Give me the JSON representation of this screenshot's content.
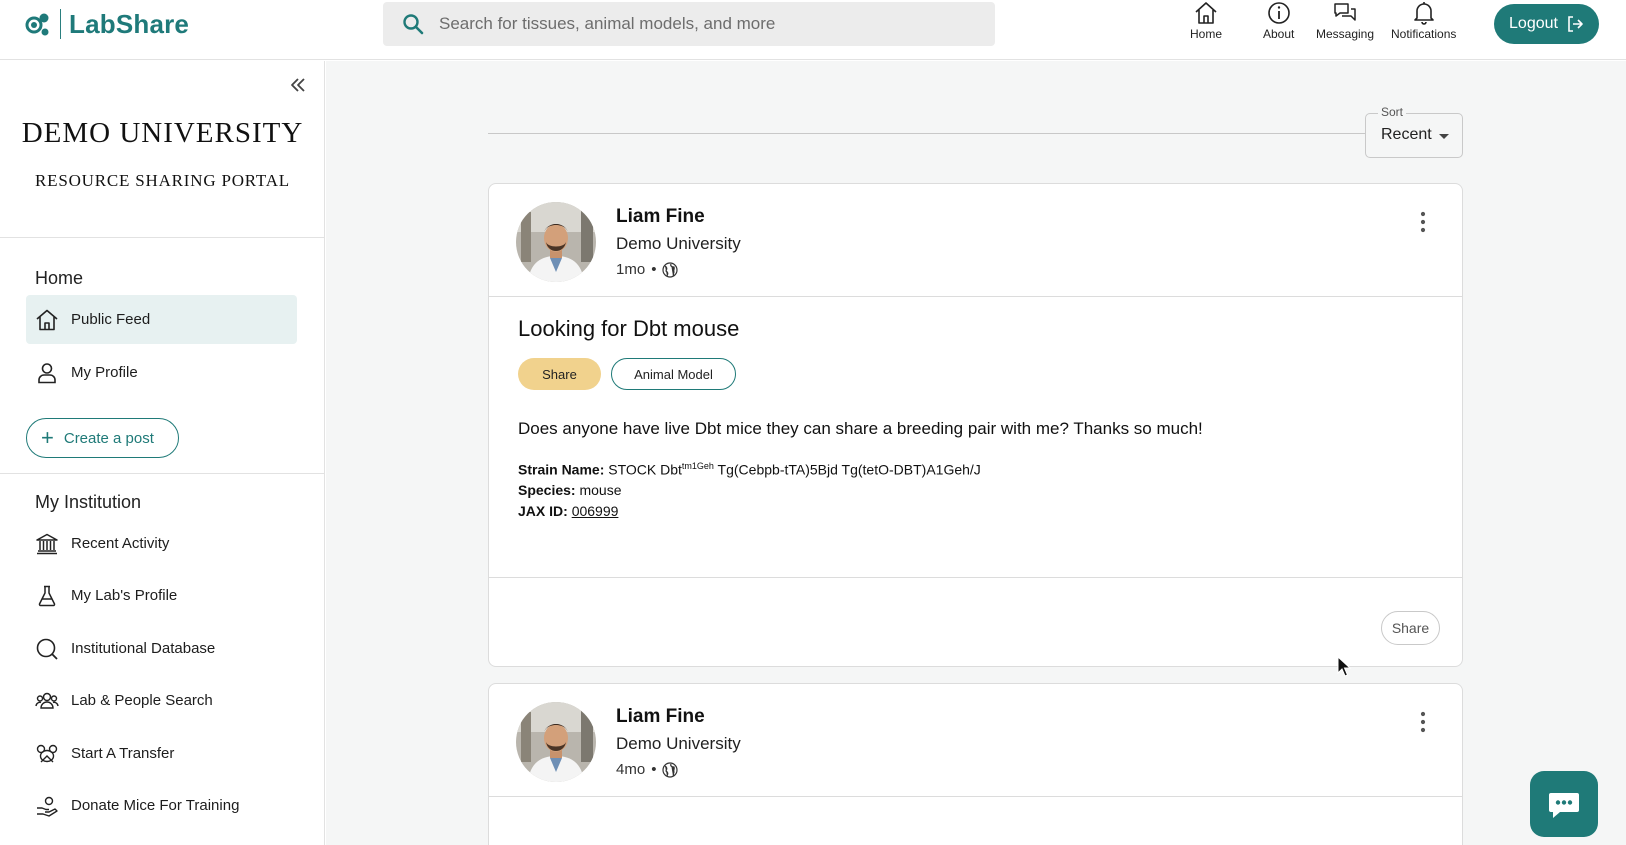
{
  "header": {
    "logo_text": "LabShare",
    "search_placeholder": "Search for tissues, animal models, and more",
    "nav": [
      {
        "label": "Home",
        "icon": "home-icon"
      },
      {
        "label": "About",
        "icon": "info-icon"
      },
      {
        "label": "Messaging",
        "icon": "messaging-icon"
      },
      {
        "label": "Notifications",
        "icon": "bell-icon"
      }
    ],
    "logout_label": "Logout"
  },
  "sidebar": {
    "university": "DEMO UNIVERSITY",
    "portal": "RESOURCE SHARING PORTAL",
    "home_section": "Home",
    "home_items": [
      {
        "label": "Public Feed",
        "icon": "home-icon",
        "active": true
      },
      {
        "label": "My Profile",
        "icon": "person-icon",
        "active": false
      }
    ],
    "create_post": "Create a post",
    "institution_section": "My Institution",
    "institution_items": [
      {
        "label": "Recent Activity",
        "icon": "institution-icon"
      },
      {
        "label": "My Lab's Profile",
        "icon": "flask-icon"
      },
      {
        "label": "Institutional Database",
        "icon": "search-icon"
      },
      {
        "label": "Lab & People Search",
        "icon": "people-icon"
      },
      {
        "label": "Start A Transfer",
        "icon": "transfer-icon"
      },
      {
        "label": "Donate Mice For Training",
        "icon": "donate-icon"
      }
    ]
  },
  "sort": {
    "label": "Sort",
    "value": "Recent"
  },
  "posts": [
    {
      "author": "Liam Fine",
      "institution": "Demo University",
      "age": "1mo",
      "title": "Looking for Dbt mouse",
      "tag_primary": "Share",
      "tag_secondary": "Animal Model",
      "body": "Does anyone have live Dbt mice they can share a breeding pair with me? Thanks so much!",
      "strain_label": "Strain Name:",
      "strain_prefix": "STOCK Dbt",
      "strain_sup": "tm1Geh",
      "strain_suffix": " Tg(Cebpb-tTA)5Bjd Tg(tetO-DBT)A1Geh/J",
      "species_label": "Species:",
      "species": "mouse",
      "jax_label": "JAX ID:",
      "jax_id": "006999",
      "share_button": "Share"
    },
    {
      "author": "Liam Fine",
      "institution": "Demo University",
      "age": "4mo"
    }
  ],
  "colors": {
    "brand": "#1f7a78",
    "share_tag": "#f1d28d",
    "active_nav_bg": "#e7f1f1",
    "main_bg": "#f5f6f6"
  }
}
